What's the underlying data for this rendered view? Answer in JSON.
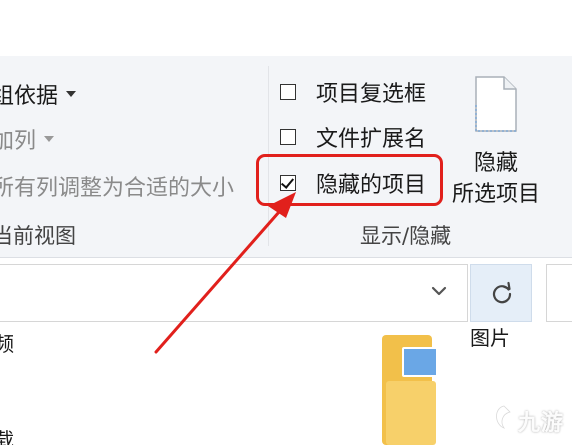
{
  "ribbon": {
    "left_items": {
      "group_by": "组依据",
      "add_column": "加列",
      "size_columns": "所有列调整为合适的大小",
      "current_view": "当前视图"
    },
    "show_hide": {
      "checkboxes": [
        {
          "label": "项目复选框",
          "checked": false
        },
        {
          "label": "文件扩展名",
          "checked": false
        },
        {
          "label": "隐藏的项目",
          "checked": true
        }
      ],
      "hide_selected_line1": "隐藏",
      "hide_selected_line2": "所选项目",
      "group_title": "显示/隐藏"
    }
  },
  "files": {
    "left_partial_top": "频",
    "left_partial_bottom": "载",
    "pictures_label": "图片"
  },
  "watermark": {
    "text": "九游"
  },
  "colors": {
    "highlight": "#e1201c",
    "ribbon_bg": "#f3f5f8",
    "refresh_bg": "#e5eef8",
    "folder": "#f2c04a"
  },
  "icons": {
    "document": "document-icon",
    "refresh": "refresh-icon",
    "chevron": "chevron-down-icon",
    "folder": "folder-icon"
  }
}
